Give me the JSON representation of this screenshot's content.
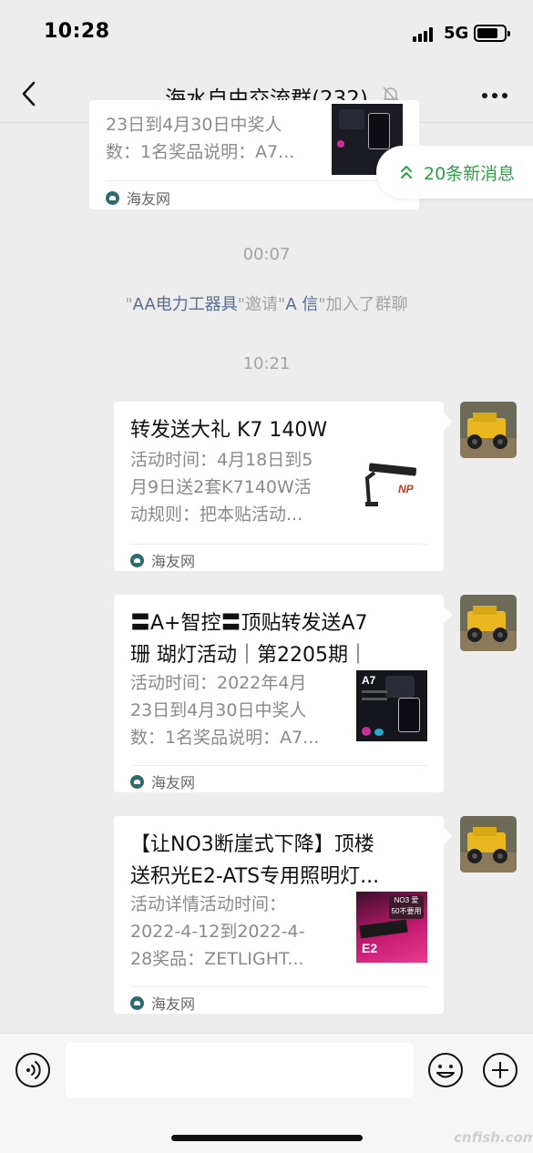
{
  "status_bar": {
    "time": "10:28",
    "network": "5G"
  },
  "nav": {
    "title": "海水自由交流群(232)"
  },
  "new_messages": {
    "label": "20条新消息"
  },
  "top_card": {
    "desc_lines": [
      "23日到4月30日中奖人",
      "数：1名奖品说明：A7..."
    ],
    "source": "海友网"
  },
  "timestamps": [
    "00:07",
    "10:21"
  ],
  "system_message": {
    "q1": "\"",
    "inviter": "AA电力工器具",
    "mid": "\"邀请\"",
    "invitee": "A 信",
    "suffix": "\"加入了群聊"
  },
  "messages": [
    {
      "title_lines": [
        "转发送大礼 K7 140W"
      ],
      "desc_lines": [
        "活动时间：4月18日到5",
        "月9日送2套K7140W活",
        "动规则：把本贴活动..."
      ],
      "source": "海友网"
    },
    {
      "title_lines": [
        "〓A+智控〓顶贴转发送A7",
        "珊 瑚灯活动｜第2205期｜"
      ],
      "desc_lines": [
        "活动时间：2022年4月",
        "23日到4月30日中奖人",
        "数：1名奖品说明：A7..."
      ],
      "source": "海友网"
    },
    {
      "title_lines": [
        "【让NO3断崖式下降】顶楼",
        "送积光E2-ATS专用照明灯..."
      ],
      "desc_lines": [
        "活动详情活动时间：",
        "2022-4-12到2022-4-",
        "28奖品：ZETLIGHT..."
      ],
      "source": "海友网"
    }
  ],
  "thumb_text": {
    "a7": "A7",
    "e2_lines": [
      "NO3 爱",
      "50不要用"
    ],
    "e2_model": "E2"
  },
  "watermark": "cnfish.com",
  "colors": {
    "background": "#ededed",
    "accent_green": "#2ba245",
    "link_blue": "#586c94",
    "muted_text": "#a3a3a3"
  }
}
